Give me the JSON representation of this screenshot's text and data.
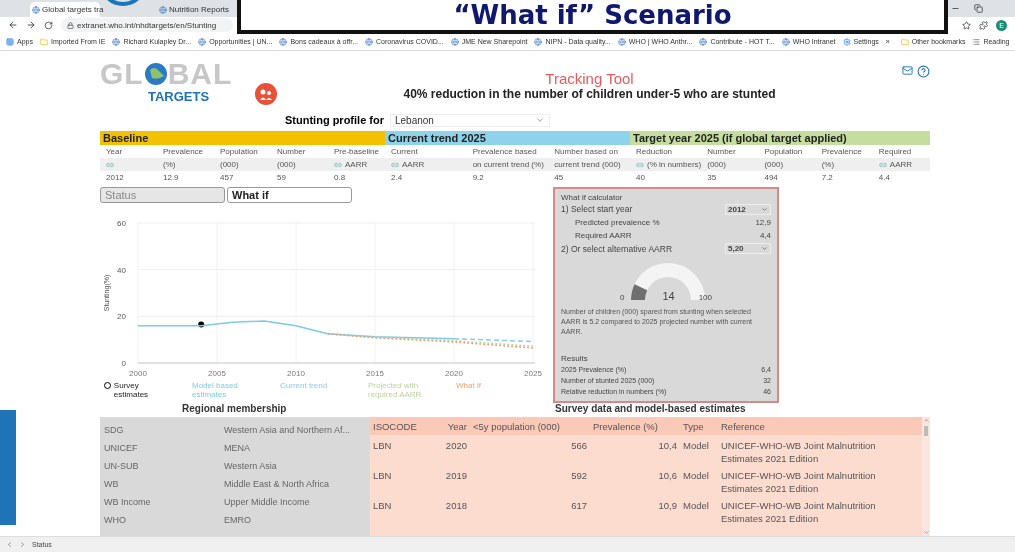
{
  "overlay": {
    "banner": "“What if” Scenario"
  },
  "browser": {
    "tabs": [
      {
        "title": "Global targets tra",
        "selected": true
      },
      {
        "title": "Nutrition Reports",
        "selected": false
      }
    ],
    "address": "extranet.who.int/nhdtargets/en/Stunting",
    "profile": "E",
    "bookmarks": [
      {
        "label": "Apps",
        "kind": "apps"
      },
      {
        "label": "Imported From IE",
        "kind": "folder"
      },
      {
        "label": "Richard Kulapley Dr...",
        "kind": "site"
      },
      {
        "label": "Opportunities | UN...",
        "kind": "site"
      },
      {
        "label": "Bons cadeaux à offr...",
        "kind": "site"
      },
      {
        "label": "Coronavirus COVID...",
        "kind": "site"
      },
      {
        "label": "JME New Sharepoint",
        "kind": "site"
      },
      {
        "label": "NIPN - Data quality...",
        "kind": "site"
      },
      {
        "label": "WHO | WHO Anthr...",
        "kind": "site"
      },
      {
        "label": "Contribute - HOT T...",
        "kind": "site"
      },
      {
        "label": "WHO Intranet",
        "kind": "site"
      },
      {
        "label": "Settings",
        "kind": "gear"
      },
      {
        "label": "»",
        "kind": "more"
      },
      {
        "label": "Other bookmarks",
        "kind": "folder"
      },
      {
        "label": "Reading",
        "kind": "list"
      }
    ]
  },
  "logo": {
    "start": "GL",
    "end": "BAL",
    "sub": "TARGETS"
  },
  "title": "Tracking Tool",
  "subtitle": "40% reduction in the number of children under-5 who are stunted",
  "profile": {
    "label": "Stunting profile for",
    "value": "Lebanon"
  },
  "summary": [
    {
      "title": "Baseline",
      "color": "#f2c200",
      "columns": [
        {
          "line1": "Year",
          "icon": true,
          "value": "2012"
        },
        {
          "line1": "Prevalence",
          "line2": "(%)",
          "icon": false,
          "value": "12.9"
        },
        {
          "line1": "Population",
          "line2": "(000)",
          "icon": false,
          "value": "457"
        },
        {
          "line1": "Number",
          "line2": "(000)",
          "icon": false,
          "value": "59"
        },
        {
          "line1": "Pre-baseline",
          "line2": "AARR",
          "icon": true,
          "value": "0.8"
        }
      ]
    },
    {
      "title": "Current trend 2025",
      "color": "#8fd3ea",
      "columns": [
        {
          "line1": "Current",
          "line2": "AARR",
          "icon": true,
          "value": "2.4"
        },
        {
          "line1": "Prevalence based",
          "line2": "on current trend (%)",
          "icon": false,
          "value": "9.2"
        },
        {
          "line1": "Number based on",
          "line2": "current trend (000)",
          "icon": false,
          "value": "45"
        }
      ]
    },
    {
      "title": "Target year 2025 (if global target applied)",
      "color": "#c5dea0",
      "columns": [
        {
          "line1": "Reduction",
          "line2": "(% in numbers)",
          "icon": true,
          "value": "40"
        },
        {
          "line1": "Number",
          "line2": "(000)",
          "icon": false,
          "value": "35"
        },
        {
          "line1": "Population",
          "line2": "(000)",
          "icon": false,
          "value": "494"
        },
        {
          "line1": "Prevalence",
          "line2": "(%)",
          "icon": false,
          "value": "7.2"
        },
        {
          "line1": "Required",
          "line2": "AARR",
          "icon": true,
          "value": "4.4"
        }
      ]
    }
  ],
  "view_tabs": [
    {
      "label": "Status",
      "selected": false
    },
    {
      "label": "What if",
      "selected": true
    }
  ],
  "chart_data": {
    "type": "line",
    "ylabel": "Stunting(%)",
    "x": [
      2000,
      2004,
      2006,
      2008,
      2010,
      2012,
      2015,
      2020,
      2025
    ],
    "xlim": [
      2000,
      2025
    ],
    "ylim": [
      0,
      60
    ],
    "xticks": [
      2000,
      2005,
      2010,
      2015,
      2020,
      2025
    ],
    "yticks": [
      0,
      20,
      40,
      60
    ],
    "grid": true,
    "series": [
      {
        "name": "Survey estimates",
        "color": "#000000",
        "marker": "circle",
        "line_style": "none",
        "values": [
          null,
          16.5,
          null,
          null,
          null,
          null,
          null,
          null,
          null
        ]
      },
      {
        "name": "Model based estimates",
        "color": "#7ccbe0",
        "line_style": "solid",
        "values": [
          16,
          16,
          17.5,
          18,
          16,
          12.5,
          11.2,
          10.4,
          null
        ]
      },
      {
        "name": "Current trend",
        "color": "#8fc8e8",
        "line_style": "dashed",
        "values": [
          null,
          null,
          null,
          null,
          null,
          null,
          null,
          10.4,
          9.2
        ]
      },
      {
        "name": "Projected with required AARR",
        "color": "#b9d49a",
        "line_style": "dotted",
        "values": [
          null,
          null,
          null,
          null,
          null,
          12.5,
          11,
          9.5,
          7.2
        ]
      },
      {
        "name": "What if",
        "color": "#f0a070",
        "line_style": "dotted",
        "values": [
          null,
          null,
          null,
          null,
          null,
          12.5,
          10.8,
          9,
          6.4
        ]
      }
    ]
  },
  "calculator": {
    "title": "What if calculator",
    "rows": [
      {
        "kind": "select",
        "label": "1) Select start year",
        "value": "2012"
      },
      {
        "kind": "value",
        "label": "Predicted prevalence %",
        "value": "12,9"
      },
      {
        "kind": "value",
        "label": "Required AARR",
        "value": "4,4"
      },
      {
        "kind": "select",
        "label": "2) Or select alternative AARR",
        "value": "5,20"
      }
    ],
    "gauge": {
      "level": 0.14,
      "min": "0",
      "reading": "14",
      "max": "100"
    },
    "note": "Number of children (000) spared from stunting when selected AARR is 5.2 compared to 2025 projected number with current AARR.",
    "results_title": "Results",
    "results": [
      {
        "label": "2025 Prevalence (%)",
        "value": "6,4"
      },
      {
        "label": "Number of stunted 2025 (000)",
        "value": "32"
      },
      {
        "label": "Relative reduction in numbers (%)",
        "value": "46"
      }
    ]
  },
  "regional": {
    "title": "Regional membership",
    "rows": [
      {
        "group": "SDG",
        "region": "Western Asia and Northern Af..."
      },
      {
        "group": "UNICEF",
        "region": "MENA"
      },
      {
        "group": "UN-SUB",
        "region": "Western Asia"
      },
      {
        "group": "WB",
        "region": "Middle East & North Africa"
      },
      {
        "group": "WB Income",
        "region": "Upper Middle Income"
      },
      {
        "group": "WHO",
        "region": "EMRO"
      }
    ]
  },
  "survey": {
    "title": "Survey data and model-based estimates",
    "columns": [
      "ISOCODE",
      "Year",
      "<5y population (000)",
      "Prevalence (%)",
      "Type",
      "Reference"
    ],
    "rows": [
      [
        "LBN",
        "2020",
        "566",
        "10,4",
        "Model",
        "UNICEF-WHO-WB Joint Malnutrition Estimates 2021 Edition"
      ],
      [
        "LBN",
        "2019",
        "592",
        "10,6",
        "Model",
        "UNICEF-WHO-WB Joint Malnutrition Estimates 2021 Edition"
      ],
      [
        "LBN",
        "2018",
        "617",
        "10,9",
        "Model",
        "UNICEF-WHO-WB Joint Malnutrition Estimates 2021 Edition"
      ]
    ]
  },
  "status_bar": {
    "label": "Status"
  }
}
